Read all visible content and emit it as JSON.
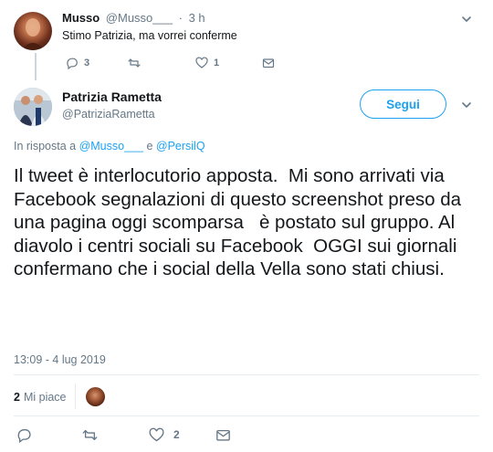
{
  "reply": {
    "name": "Musso",
    "handle": "@Musso___",
    "separator": "·",
    "time": "3 h",
    "text": "Stimo Patrizia, ma vorrei conferme",
    "reply_count": "3",
    "like_count": "1"
  },
  "tweet": {
    "name": "Patrizia Rametta",
    "handle": "@PatriziaRametta",
    "follow_label": "Segui",
    "reply_to_prefix": "In risposta a",
    "reply_to_user1": "@Musso___",
    "reply_to_conj": "e",
    "reply_to_user2": "@PersilQ",
    "text": "Il tweet è interlocutorio apposta.  Mi sono arrivati via Facebook segnalazioni di questo screenshot preso da una pagina oggi scomparsa   è postato sul gruppo. Al diavolo i centri sociali su Facebook  OGGI sui giornali confermano che i social della Vella sono stati chiusi.",
    "timestamp": "13:09 - 4 lug 2019",
    "likes_count": "2",
    "likes_label": "Mi piace",
    "like_count_action": "2"
  },
  "colors": {
    "accent": "#1da1f2",
    "muted": "#657786",
    "divider": "#e6ecf0"
  }
}
